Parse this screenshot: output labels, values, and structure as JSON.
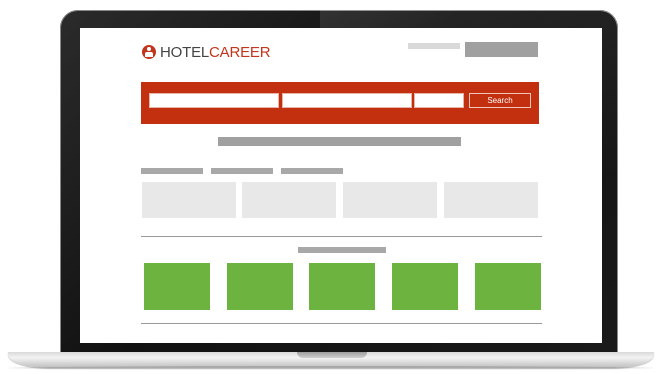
{
  "brand": {
    "name_part1": "HOTEL",
    "name_part2": "CAREER",
    "color_primary": "#c1361c",
    "color_text": "#444444"
  },
  "search": {
    "button_label": "Search",
    "band_color": "#c3300f"
  },
  "tiles": {
    "tab_count": 3,
    "grey_tile_count": 4,
    "green_tile_count": 5,
    "green_color": "#6cb33f"
  },
  "icons": {
    "logo": "person-in-circle-icon"
  }
}
